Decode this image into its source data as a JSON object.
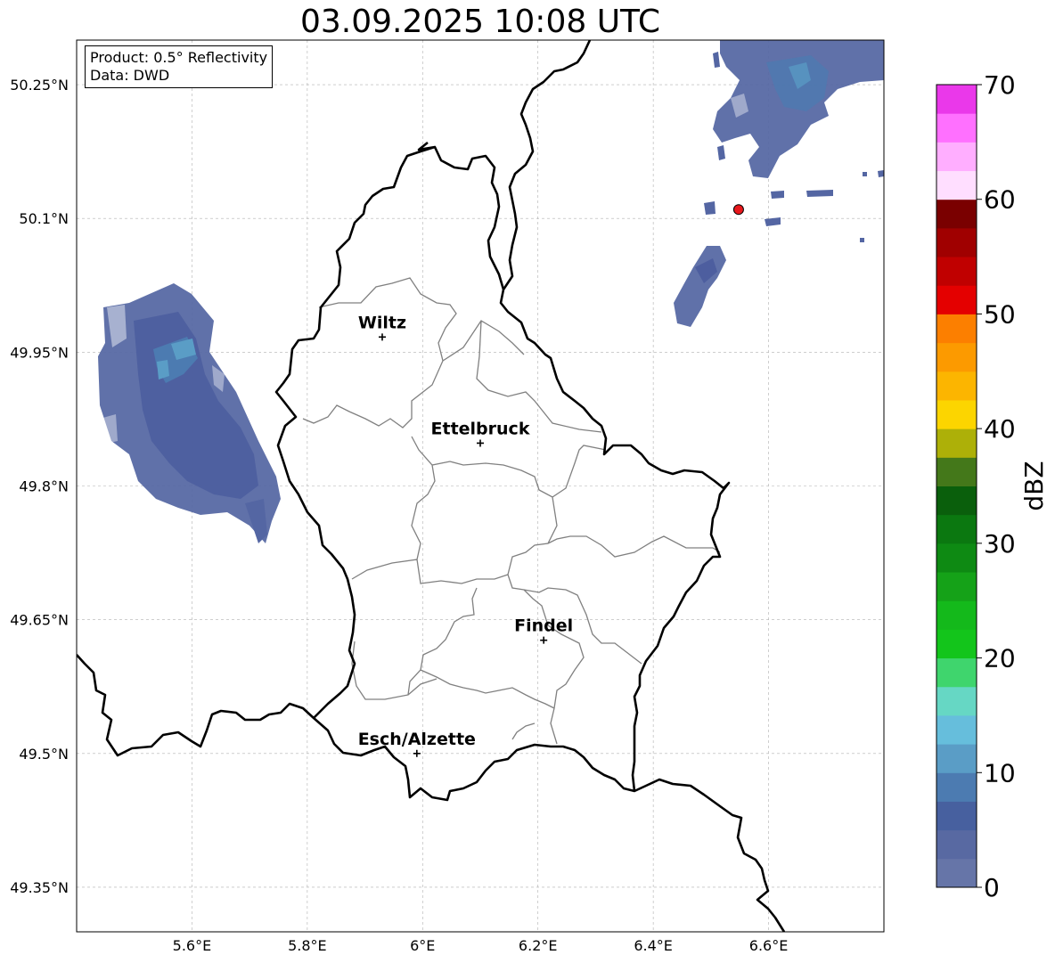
{
  "title": "03.09.2025 10:08 UTC",
  "info": {
    "product": "Product: 0.5° Reflectivity",
    "source": "Data: DWD"
  },
  "map": {
    "lon_range": [
      5.4,
      6.8
    ],
    "lat_range": [
      49.3,
      50.3
    ],
    "lon_ticks": [
      {
        "value": 5.6,
        "label": "5.6°E"
      },
      {
        "value": 5.8,
        "label": "5.8°E"
      },
      {
        "value": 6.0,
        "label": "6°E"
      },
      {
        "value": 6.2,
        "label": "6.2°E"
      },
      {
        "value": 6.4,
        "label": "6.4°E"
      },
      {
        "value": 6.6,
        "label": "6.6°E"
      }
    ],
    "lat_ticks": [
      {
        "value": 49.35,
        "label": "49.35°N"
      },
      {
        "value": 49.5,
        "label": "49.5°N"
      },
      {
        "value": 49.65,
        "label": "49.65°N"
      },
      {
        "value": 49.8,
        "label": "49.8°N"
      },
      {
        "value": 49.95,
        "label": "49.95°N"
      },
      {
        "value": 50.1,
        "label": "50.1°N"
      },
      {
        "value": 50.25,
        "label": "50.25°N"
      }
    ],
    "grid": true,
    "cities": [
      {
        "name": "Wiltz",
        "lon": 5.93,
        "lat": 49.967
      },
      {
        "name": "Ettelbruck",
        "lon": 6.1,
        "lat": 49.848
      },
      {
        "name": "Findel",
        "lon": 6.21,
        "lat": 49.627
      },
      {
        "name": "Esch/Alzette",
        "lon": 5.99,
        "lat": 49.5
      }
    ],
    "radar_site": {
      "lon": 6.548,
      "lat": 50.11,
      "color": "#e8181c"
    },
    "echo_regions": [
      {
        "id": "west-band",
        "max_dbz": 12
      },
      {
        "id": "northeast-cluster",
        "max_dbz": 10
      },
      {
        "id": "east-cell",
        "max_dbz": 5
      }
    ]
  },
  "colorbar": {
    "label": "dBZ",
    "vmin": 0,
    "vmax": 70,
    "ticks": [
      0,
      10,
      20,
      30,
      40,
      50,
      60,
      70
    ],
    "colors": [
      "#6675a8",
      "#5869a2",
      "#47609f",
      "#4c7bb1",
      "#5a9dc6",
      "#66bedc",
      "#66d7c4",
      "#3fd56d",
      "#13c51b",
      "#14b91b",
      "#15a218",
      "#0e8a13",
      "#0b7810",
      "#0a5f0c",
      "#44781a",
      "#adb008",
      "#fcd500",
      "#fcb500",
      "#fc9a00",
      "#fc7f00",
      "#e40000",
      "#c00000",
      "#a00000",
      "#7a0000",
      "#ffdeff",
      "#ffaeff",
      "#ff70ff",
      "#ea38ea"
    ]
  }
}
